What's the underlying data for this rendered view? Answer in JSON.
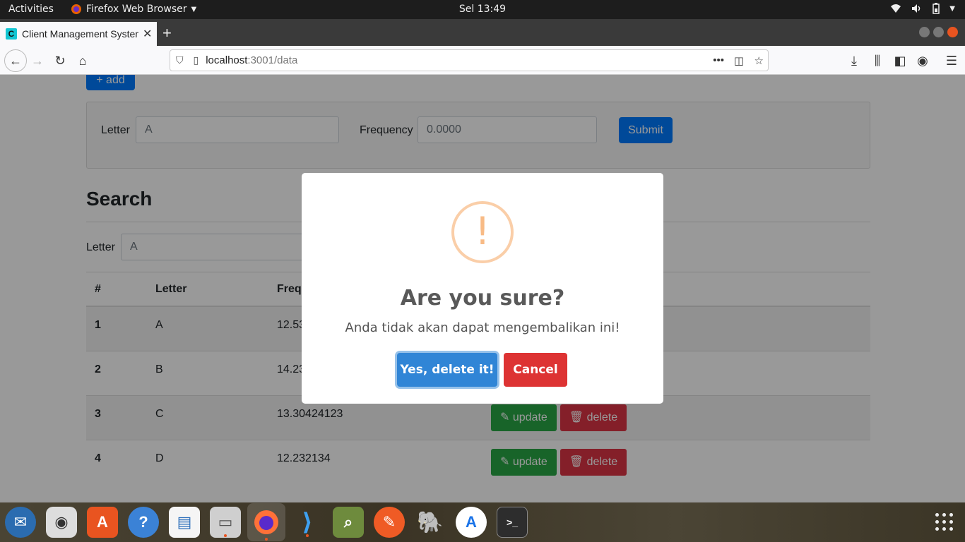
{
  "topbar": {
    "activities": "Activities",
    "app_name": "Firefox Web Browser",
    "clock": "Sel 13:49"
  },
  "browser": {
    "tab_favicon": "C",
    "tab_title": "Client Management System",
    "url_host": "localhost",
    "url_rest": ":3001/data"
  },
  "page": {
    "add_label": "+ add",
    "form": {
      "letter_label": "Letter",
      "letter_placeholder": "A",
      "frequency_label": "Frequency",
      "frequency_placeholder": "0.0000",
      "submit_label": "Submit"
    },
    "search": {
      "title": "Search",
      "letter_label": "Letter",
      "letter_placeholder": "A"
    },
    "table": {
      "headers": [
        "#",
        "Letter",
        "Frequ"
      ],
      "rows": [
        {
          "num": "1",
          "letter": "A",
          "frequency": "12.53"
        },
        {
          "num": "2",
          "letter": "B",
          "frequency": "14.23"
        },
        {
          "num": "3",
          "letter": "C",
          "frequency": "13.30424123"
        },
        {
          "num": "4",
          "letter": "D",
          "frequency": "12.232134"
        }
      ],
      "update_label": "update",
      "delete_label": "delete"
    }
  },
  "modal": {
    "icon": "!",
    "title": "Are you sure?",
    "text": "Anda tidak akan dapat mengembalikan ini!",
    "confirm_label": "Yes, delete it!",
    "cancel_label": "Cancel"
  },
  "colors": {
    "primary": "#007bff",
    "success": "#28a745",
    "danger": "#dc3545",
    "confirm": "#3085d6",
    "cancel": "#dd3333",
    "warning_icon": "#f8bb86"
  }
}
